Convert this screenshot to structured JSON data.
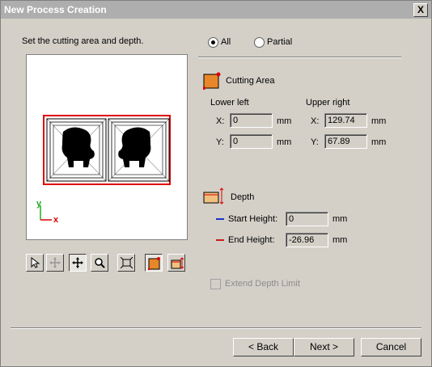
{
  "window": {
    "title": "New Process Creation",
    "close_label": "X"
  },
  "instruction": "Set the cutting area and depth.",
  "mode": {
    "all_label": "All",
    "partial_label": "Partial",
    "selected": "all"
  },
  "cutting_area": {
    "title": "Cutting Area",
    "lower_left_label": "Lower left",
    "upper_right_label": "Upper right",
    "x_label": "X:",
    "y_label": "Y:",
    "lower_left_x": "0",
    "lower_left_y": "0",
    "upper_right_x": "129.74",
    "upper_right_y": "67.89",
    "unit": "mm"
  },
  "depth": {
    "title": "Depth",
    "start_label": "Start Height:",
    "start_value": "0",
    "end_label": "End Height:",
    "end_value": "-26.96",
    "unit": "mm",
    "start_line_color": "#1a33cc",
    "end_line_color": "#cc1a1a"
  },
  "extend_depth_limit": {
    "label": "Extend Depth Limit",
    "checked": false,
    "enabled": false
  },
  "preview": {
    "axis_y": "y",
    "axis_x": "x"
  },
  "toolbar": {
    "tools": [
      "select-arrow-icon",
      "pan-disabled-icon",
      "move-icon",
      "zoom-icon",
      "fit-icon",
      "area-mode-icon",
      "depth-mode-icon"
    ]
  },
  "buttons": {
    "back": "< Back",
    "next": "Next >",
    "cancel": "Cancel"
  }
}
